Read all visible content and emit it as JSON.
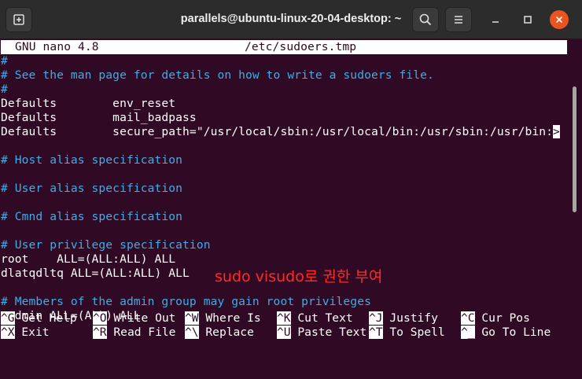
{
  "window": {
    "title": "parallels@ubuntu-linux-20-04-desktop: ~"
  },
  "nano": {
    "version": "GNU nano 4.8",
    "filename": "/etc/sudoers.tmp"
  },
  "content_lines": [
    {
      "text": "#",
      "type": "comment"
    },
    {
      "text": "# See the man page for details on how to write a sudoers file.",
      "type": "comment"
    },
    {
      "text": "#",
      "type": "comment"
    },
    {
      "text": "Defaults        env_reset",
      "type": "normal"
    },
    {
      "text": "Defaults        mail_badpass",
      "type": "normal"
    },
    {
      "text": "Defaults        secure_path=\"/usr/local/sbin:/usr/local/bin:/usr/sbin:/usr/bin:",
      "type": "normal",
      "overflow": ">"
    },
    {
      "text": "",
      "type": "normal"
    },
    {
      "text": "# Host alias specification",
      "type": "comment"
    },
    {
      "text": "",
      "type": "normal"
    },
    {
      "text": "# User alias specification",
      "type": "comment"
    },
    {
      "text": "",
      "type": "normal"
    },
    {
      "text": "# Cmnd alias specification",
      "type": "comment"
    },
    {
      "text": "",
      "type": "normal"
    },
    {
      "text": "# User privilege specification",
      "type": "comment"
    },
    {
      "text": "root    ALL=(ALL:ALL) ALL",
      "type": "normal"
    },
    {
      "text": "dlatqdltq ALL=(ALL:ALL) ALL",
      "type": "normal"
    },
    {
      "text": "",
      "type": "normal"
    },
    {
      "text": "# Members of the admin group may gain root privileges",
      "type": "comment"
    },
    {
      "text": "%admin ALL=(ALL) ALL",
      "type": "normal"
    }
  ],
  "annotation": "sudo visudo로 권한 부여",
  "shortcuts": {
    "row1": [
      {
        "key": "^G",
        "label": "Get Help"
      },
      {
        "key": "^O",
        "label": "Write Out"
      },
      {
        "key": "^W",
        "label": "Where Is"
      },
      {
        "key": "^K",
        "label": "Cut Text"
      },
      {
        "key": "^J",
        "label": "Justify"
      },
      {
        "key": "^C",
        "label": "Cur Pos"
      }
    ],
    "row2": [
      {
        "key": "^X",
        "label": "Exit"
      },
      {
        "key": "^R",
        "label": "Read File"
      },
      {
        "key": "^\\",
        "label": "Replace"
      },
      {
        "key": "^U",
        "label": "Paste Text"
      },
      {
        "key": "^T",
        "label": "To Spell"
      },
      {
        "key": "^_",
        "label": "Go To Line"
      }
    ]
  },
  "colors": {
    "terminal_bg": "#300a24",
    "comment": "#3daee9",
    "annotation": "#ff2a2a",
    "close_button": "#e95420"
  }
}
